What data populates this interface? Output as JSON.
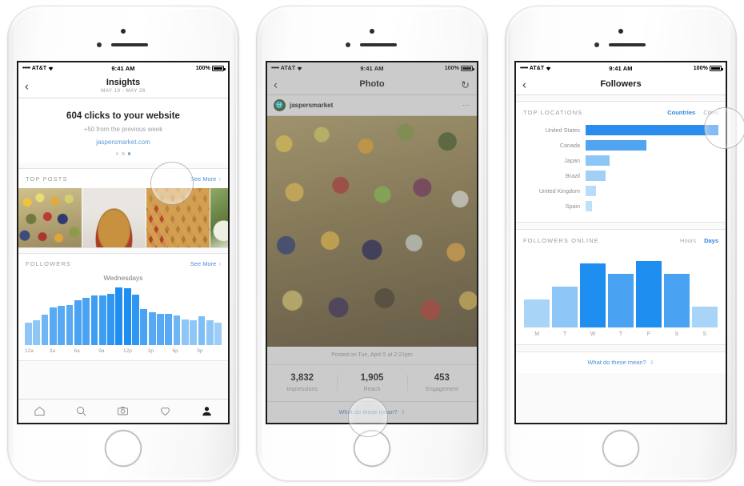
{
  "meta": {
    "scene": "three-iphone-mockup-instagram-business-insights"
  },
  "colors": {
    "accent_blue": "#2e85d8",
    "bar_blue_dark": "#1f8ef1",
    "bar_blue_mid": "#3d9ff2",
    "bar_blue_light": "#9ecdf7",
    "link_blue": "#4a90d9",
    "muted_gray": "#9b9b9b"
  },
  "status_bar": {
    "signal_dots": "•••••",
    "carrier": "AT&T",
    "wifi_icon": "wifi-icon",
    "time": "9:41 AM",
    "battery_percent": "100%",
    "battery_icon": "battery-full-icon"
  },
  "phone1": {
    "navbar": {
      "back_icon": "chevron-left-icon",
      "title": "Insights",
      "subtitle": "MAY 19 - MAY 26"
    },
    "clicks": {
      "headline": "604 clicks to your website",
      "comparison": "+50 from the previous week",
      "website": "jaspersmarket.com",
      "pagination_dots": 3,
      "pagination_active_index": 2
    },
    "top_posts": {
      "label": "TOP POSTS",
      "see_more": "See More",
      "chevron_icon": "chevron-right-icon",
      "thumbnails": [
        {
          "name": "produce-market-stall",
          "style": "t-produce"
        },
        {
          "name": "apple-pie",
          "style": "t-pie"
        },
        {
          "name": "lattice-pie-with-tomatoes",
          "style": "t-lattice"
        },
        {
          "name": "greens-and-onions",
          "style": "t-greens"
        }
      ]
    },
    "followers": {
      "label": "FOLLOWERS",
      "see_more": "See More",
      "chevron_icon": "chevron-right-icon",
      "caption": "Wednesdays"
    },
    "tabbar": {
      "items": [
        {
          "name": "tab-home",
          "icon": "home-icon",
          "active": false
        },
        {
          "name": "tab-search",
          "icon": "search-icon",
          "active": false
        },
        {
          "name": "tab-camera",
          "icon": "camera-icon",
          "active": false
        },
        {
          "name": "tab-activity",
          "icon": "heart-icon",
          "active": false
        },
        {
          "name": "tab-profile",
          "icon": "person-icon",
          "active": true
        }
      ]
    }
  },
  "phone2": {
    "navbar": {
      "back_icon": "chevron-left-icon",
      "title": "Photo",
      "refresh_icon": "refresh-icon"
    },
    "post": {
      "avatar_icon": "jaspers-market-logo",
      "username": "jaspersmarket",
      "menu_icon": "more-options-icon",
      "photo_name": "fruit-and-vegetable-market-photo",
      "posted": "Posted on Tue, April 5 at 2:21pm"
    },
    "stats": [
      {
        "value": "3,832",
        "label": "Impressions"
      },
      {
        "value": "1,905",
        "label": "Reach"
      },
      {
        "value": "453",
        "label": "Engagement"
      }
    ],
    "footer": {
      "what_mean": "What do these mean?",
      "chevron_icon": "chevron-down-icon"
    }
  },
  "phone3": {
    "navbar": {
      "back_icon": "chevron-left-icon",
      "title": "Followers"
    },
    "top_locations": {
      "label": "TOP LOCATIONS",
      "tabs": [
        {
          "label": "Countries",
          "active": true
        },
        {
          "label": "Cities",
          "active": false
        }
      ]
    },
    "followers_online": {
      "label": "FOLLOWERS ONLINE",
      "tabs": [
        {
          "label": "Hours",
          "active": false
        },
        {
          "label": "Days",
          "active": true
        }
      ]
    },
    "footer": {
      "what_mean": "What do these mean?",
      "chevron_icon": "chevron-down-icon"
    }
  },
  "chart_data": [
    {
      "type": "bar",
      "name": "followers-online-hourly",
      "title": "Wednesdays",
      "xlabel": "",
      "ylabel": "",
      "grid": false,
      "categories": [
        "12a",
        "1a",
        "2a",
        "3a",
        "4a",
        "5a",
        "6a",
        "7a",
        "8a",
        "9a",
        "10a",
        "11a",
        "12p",
        "1p",
        "2p",
        "3p",
        "4p",
        "5p",
        "6p",
        "7p",
        "8p",
        "9p",
        "10p",
        "11p"
      ],
      "tick_labels": [
        "12a",
        "3a",
        "6a",
        "9a",
        "12p",
        "3p",
        "6p",
        "9p"
      ],
      "values": [
        30,
        33,
        41,
        50,
        52,
        53,
        60,
        63,
        66,
        66,
        69,
        77,
        76,
        68,
        48,
        44,
        42,
        42,
        40,
        34,
        33,
        38,
        33,
        30
      ],
      "ylim": [
        0,
        80
      ],
      "colors": [
        "#8ec7f6",
        "#8ec7f6",
        "#6fb6f4",
        "#57a9f3",
        "#57a9f3",
        "#57a9f3",
        "#49a2f2",
        "#49a2f2",
        "#3d9ff2",
        "#3d9ff2",
        "#2f97f1",
        "#1f8ef1",
        "#1f8ef1",
        "#2f97f1",
        "#49a2f2",
        "#57a9f3",
        "#57a9f3",
        "#57a9f3",
        "#6fb6f4",
        "#8ec7f6",
        "#8ec7f6",
        "#7cbef5",
        "#8ec7f6",
        "#9ecdf7"
      ]
    },
    {
      "type": "bar",
      "name": "top-locations-countries",
      "orientation": "horizontal",
      "title": "TOP LOCATIONS",
      "xlabel": "",
      "ylabel": "",
      "grid": false,
      "categories": [
        "United States",
        "Canada",
        "Japan",
        "Brazil",
        "United Kingdom",
        "Spain"
      ],
      "values": [
        100,
        46,
        18,
        15,
        8,
        5
      ],
      "xlim": [
        0,
        100
      ],
      "colors": [
        "#2a8ced",
        "#51a5f0",
        "#8cc6f6",
        "#a0d0f8",
        "#b9dcfa",
        "#bfe0fb"
      ]
    },
    {
      "type": "bar",
      "name": "followers-online-days",
      "title": "FOLLOWERS ONLINE",
      "xlabel": "",
      "ylabel": "",
      "grid": false,
      "categories": [
        "M",
        "T",
        "W",
        "T",
        "F",
        "S",
        "S"
      ],
      "values": [
        36,
        52,
        82,
        68,
        85,
        68,
        27
      ],
      "ylim": [
        0,
        100
      ],
      "colors": [
        "#a8d4f8",
        "#8cc6f6",
        "#1f8ef1",
        "#4aa3f2",
        "#1f8ef1",
        "#4aa3f2",
        "#a8d4f8"
      ]
    }
  ]
}
